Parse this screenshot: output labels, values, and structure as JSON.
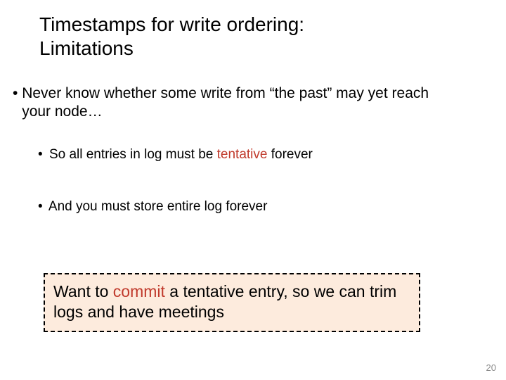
{
  "title_l1": "Timestamps for write ordering:",
  "title_l2": "Limitations",
  "b1_pre": "Never know whether some write from “the past” may yet reach your node…",
  "b2_pre": "So all entries in log must be ",
  "b2_hl": "tentative",
  "b2_post": " forever",
  "b3": "And you must store entire log forever",
  "callout_pre": "Want to ",
  "callout_hl": "commit",
  "callout_post": " a tentative entry, so we can trim logs and have meetings",
  "page": "20"
}
